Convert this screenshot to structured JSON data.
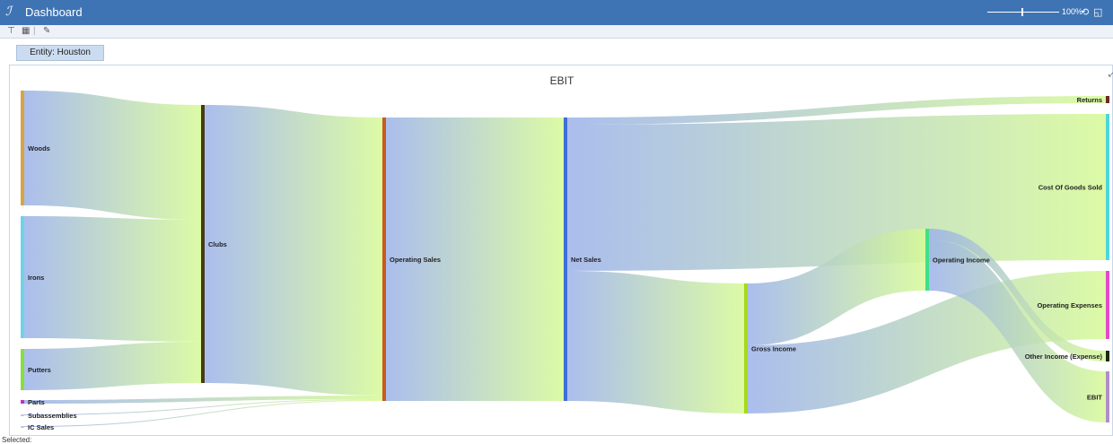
{
  "window": {
    "title": "Dashboard",
    "zoom": "100%"
  },
  "toolbar": {
    "icons": [
      "filter-icon",
      "grid-icon",
      "edit-icon"
    ]
  },
  "entity_button": {
    "label": "Entity: Houston"
  },
  "status": {
    "text": "Selected:"
  },
  "chart_data": {
    "type": "sankey",
    "title": "EBIT",
    "nodes": [
      {
        "id": "Woods",
        "label": "Woods",
        "color": "#d9a441"
      },
      {
        "id": "Irons",
        "label": "Irons",
        "color": "#6fd3e6"
      },
      {
        "id": "Putters",
        "label": "Putters",
        "color": "#86df3c"
      },
      {
        "id": "Parts",
        "label": "Parts",
        "color": "#c12fc8"
      },
      {
        "id": "Subassemblies",
        "label": "Subassemblies",
        "color": "#c9c9c9"
      },
      {
        "id": "ICSales",
        "label": "IC Sales",
        "color": "#c9c9c9"
      },
      {
        "id": "Clubs",
        "label": "Clubs",
        "color": "#4a3a12"
      },
      {
        "id": "OperatingSales",
        "label": "Operating Sales",
        "color": "#c85a1e"
      },
      {
        "id": "NetSales",
        "label": "Net Sales",
        "color": "#3e6fd8"
      },
      {
        "id": "GrossIncome",
        "label": "Gross Income",
        "color": "#a8d91f"
      },
      {
        "id": "OperatingIncome",
        "label": "Operating Income",
        "color": "#3fe08a"
      },
      {
        "id": "Returns",
        "label": "Returns",
        "color": "#6a2a2a"
      },
      {
        "id": "COGS",
        "label": "Cost Of Goods Sold",
        "color": "#4fd6dc"
      },
      {
        "id": "OperatingExpenses",
        "label": "Operating Expenses",
        "color": "#e548c9"
      },
      {
        "id": "OtherIncome",
        "label": "Other Income (Expense)",
        "color": "#1d2b12"
      },
      {
        "id": "EBIT",
        "label": "EBIT",
        "color": "#b38dc8"
      }
    ],
    "links": [
      {
        "source": "Woods",
        "target": "Clubs",
        "value": 128
      },
      {
        "source": "Irons",
        "target": "Clubs",
        "value": 136
      },
      {
        "source": "Putters",
        "target": "Clubs",
        "value": 46
      },
      {
        "source": "Clubs",
        "target": "OperatingSales",
        "value": 310
      },
      {
        "source": "Parts",
        "target": "OperatingSales",
        "value": 4
      },
      {
        "source": "Subassemblies",
        "target": "OperatingSales",
        "value": 1
      },
      {
        "source": "ICSales",
        "target": "OperatingSales",
        "value": 1
      },
      {
        "source": "OperatingSales",
        "target": "NetSales",
        "value": 316
      },
      {
        "source": "NetSales",
        "target": "Returns",
        "value": 8
      },
      {
        "source": "NetSales",
        "target": "COGS",
        "value": 163
      },
      {
        "source": "NetSales",
        "target": "GrossIncome",
        "value": 145
      },
      {
        "source": "GrossIncome",
        "target": "OperatingIncome",
        "value": 69
      },
      {
        "source": "GrossIncome",
        "target": "OperatingExpenses",
        "value": 76
      },
      {
        "source": "OperatingIncome",
        "target": "OtherIncome",
        "value": 12
      },
      {
        "source": "OperatingIncome",
        "target": "EBIT",
        "value": 57
      }
    ]
  }
}
